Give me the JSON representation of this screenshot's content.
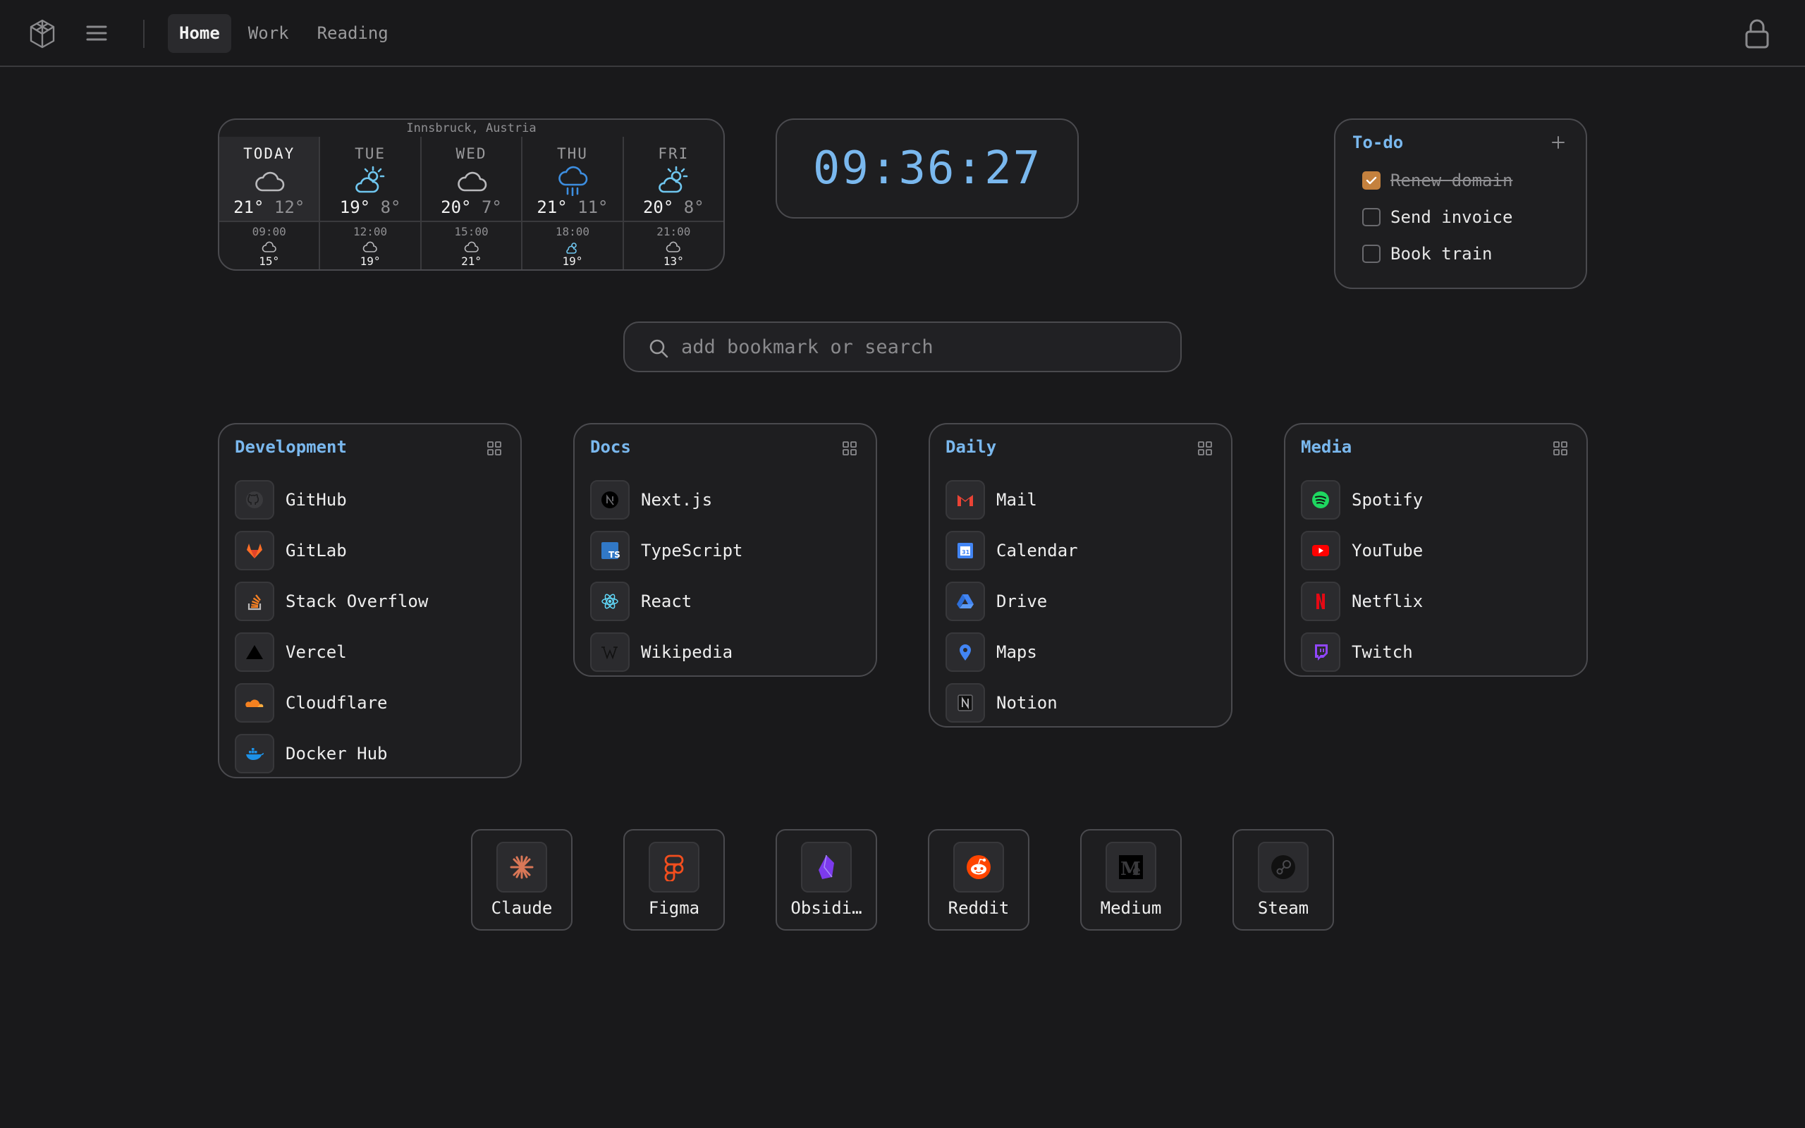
{
  "topbar": {
    "tabs": [
      {
        "label": "Home",
        "active": true
      },
      {
        "label": "Work",
        "active": false
      },
      {
        "label": "Reading",
        "active": false
      }
    ],
    "icons": {
      "logo": "cube-logo-icon",
      "menu": "hamburger-menu-icon",
      "lock": "lock-icon"
    }
  },
  "weather": {
    "location": "Innsbruck, Austria",
    "days": [
      {
        "name": "TODAY",
        "icon": "cloud",
        "hi": "21°",
        "lo": "12°"
      },
      {
        "name": "TUE",
        "icon": "partly-sunny",
        "hi": "19°",
        "lo": "8°"
      },
      {
        "name": "WED",
        "icon": "cloud",
        "hi": "20°",
        "lo": "7°"
      },
      {
        "name": "THU",
        "icon": "rain",
        "hi": "21°",
        "lo": "11°"
      },
      {
        "name": "FRI",
        "icon": "partly-sunny",
        "hi": "20°",
        "lo": "8°"
      }
    ],
    "hours": [
      {
        "time": "09:00",
        "icon": "cloud",
        "temp": "15°"
      },
      {
        "time": "12:00",
        "icon": "cloud",
        "temp": "19°"
      },
      {
        "time": "15:00",
        "icon": "cloud",
        "temp": "21°"
      },
      {
        "time": "18:00",
        "icon": "partly-sunny",
        "temp": "19°"
      },
      {
        "time": "21:00",
        "icon": "cloud",
        "temp": "13°"
      }
    ]
  },
  "clock": {
    "time": "09:36:27",
    "color": "#7ab8ee"
  },
  "todo": {
    "title": "To-do",
    "items": [
      {
        "label": "Renew domain",
        "done": true
      },
      {
        "label": "Send invoice",
        "done": false
      },
      {
        "label": "Book train",
        "done": false
      }
    ],
    "check_color": "#c4813e"
  },
  "search": {
    "placeholder": "add bookmark or search"
  },
  "groups": [
    {
      "title": "Development",
      "items": [
        {
          "label": "GitHub",
          "icon": "github-icon"
        },
        {
          "label": "GitLab",
          "icon": "gitlab-icon"
        },
        {
          "label": "Stack Overflow",
          "icon": "stackoverflow-icon"
        },
        {
          "label": "Vercel",
          "icon": "vercel-icon"
        },
        {
          "label": "Cloudflare",
          "icon": "cloudflare-icon"
        },
        {
          "label": "Docker Hub",
          "icon": "docker-icon"
        }
      ]
    },
    {
      "title": "Docs",
      "items": [
        {
          "label": "Next.js",
          "icon": "nextjs-icon"
        },
        {
          "label": "TypeScript",
          "icon": "typescript-icon"
        },
        {
          "label": "React",
          "icon": "react-icon"
        },
        {
          "label": "Wikipedia",
          "icon": "wikipedia-icon"
        }
      ]
    },
    {
      "title": "Daily",
      "items": [
        {
          "label": "Mail",
          "icon": "gmail-icon"
        },
        {
          "label": "Calendar",
          "icon": "calendar-icon"
        },
        {
          "label": "Drive",
          "icon": "drive-icon"
        },
        {
          "label": "Maps",
          "icon": "maps-pin-icon"
        },
        {
          "label": "Notion",
          "icon": "notion-icon"
        }
      ]
    },
    {
      "title": "Media",
      "items": [
        {
          "label": "Spotify",
          "icon": "spotify-icon"
        },
        {
          "label": "YouTube",
          "icon": "youtube-icon"
        },
        {
          "label": "Netflix",
          "icon": "netflix-icon"
        },
        {
          "label": "Twitch",
          "icon": "twitch-icon"
        }
      ]
    }
  ],
  "tiles": [
    {
      "label": "Claude",
      "icon": "claude-icon"
    },
    {
      "label": "Figma",
      "icon": "figma-icon"
    },
    {
      "label": "Obsidi…",
      "icon": "obsidian-icon"
    },
    {
      "label": "Reddit",
      "icon": "reddit-icon"
    },
    {
      "label": "Medium",
      "icon": "medium-icon"
    },
    {
      "label": "Steam",
      "icon": "steam-icon"
    }
  ],
  "colors": {
    "background": "#19191b",
    "accent": "#7ab8ee",
    "border": "#4a4a4e"
  }
}
